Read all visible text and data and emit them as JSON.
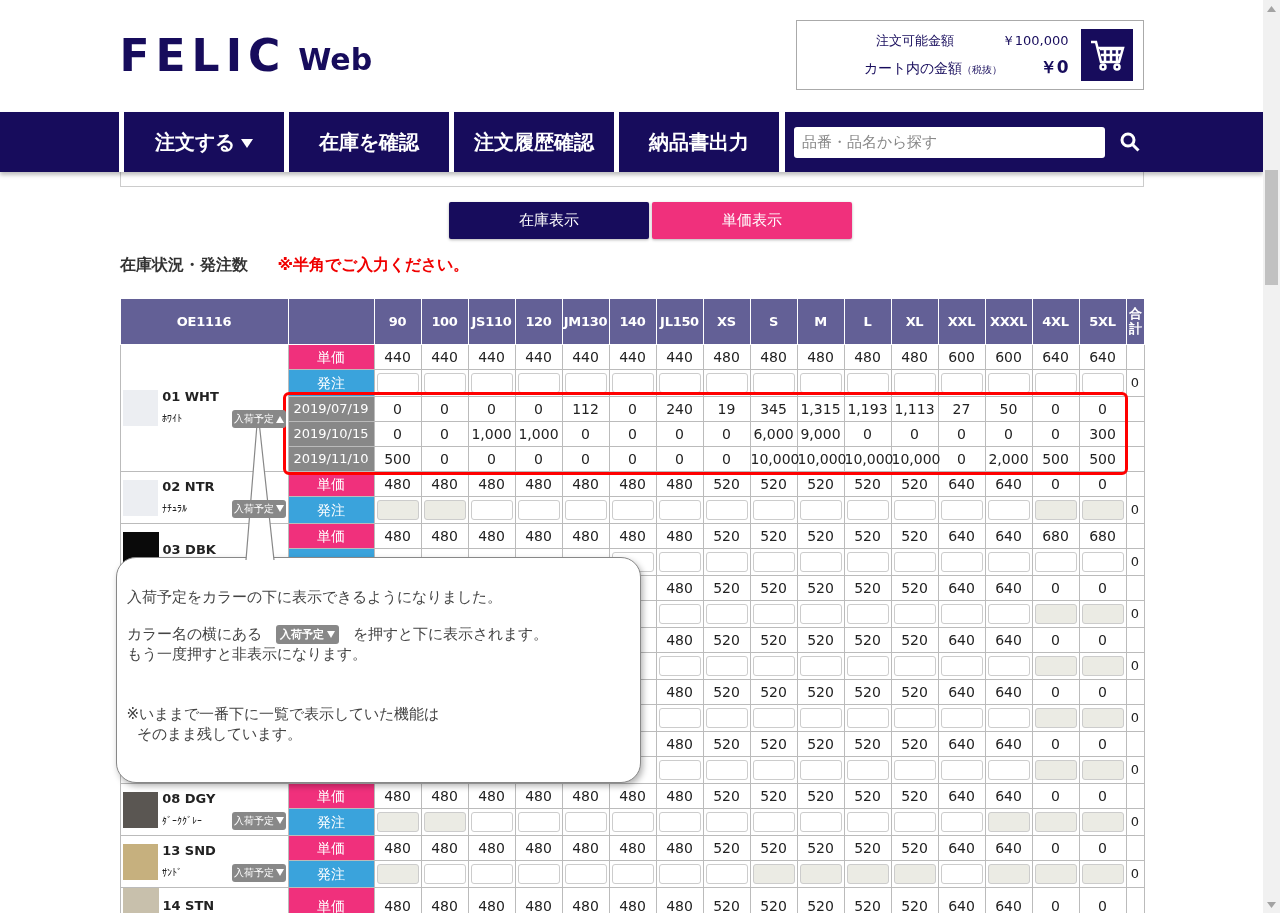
{
  "header": {
    "logo": "FELIC",
    "logo_suffix": "Web",
    "available_label": "注文可能金額",
    "available_value": "￥100,000",
    "cart_label": "カート内の金額",
    "cart_note": "（税抜）",
    "cart_value": "￥0"
  },
  "nav": {
    "items": [
      {
        "label": "注文する",
        "dropdown": true
      },
      {
        "label": "在庫を確認",
        "dropdown": false
      },
      {
        "label": "注文履歴確認",
        "dropdown": false
      },
      {
        "label": "納品書出力",
        "dropdown": false
      }
    ],
    "search": {
      "placeholder": "品番・品名から探す"
    }
  },
  "view_toggle": [
    {
      "label": "在庫表示",
      "selected": false
    },
    {
      "label": "単価表示",
      "selected": true
    }
  ],
  "heading": "在庫状況・発注数",
  "notice": "※半角でご入力ください。",
  "table": {
    "product": "OE1116",
    "sizes": [
      "90",
      "100",
      "JS110",
      "120",
      "JM130",
      "140",
      "JL150",
      "XS",
      "S",
      "M",
      "L",
      "XL",
      "XXL",
      "XXXL",
      "4XL",
      "5XL"
    ],
    "total_header": "合計",
    "blocks": [
      {
        "name": "01 WHT",
        "sub": "ﾎﾜｲﾄ",
        "color": "#eceef2",
        "arrivals_button": {
          "label": "入荷予定",
          "expanded": true
        },
        "price_label": "単価",
        "prices": [
          "440",
          "440",
          "440",
          "440",
          "440",
          "440",
          "440",
          "480",
          "480",
          "480",
          "480",
          "480",
          "600",
          "600",
          "640",
          "640"
        ],
        "order_label": "発注",
        "order_disabled": [
          false,
          false,
          false,
          false,
          false,
          false,
          false,
          false,
          false,
          false,
          false,
          false,
          false,
          false,
          false,
          false
        ],
        "total": "0",
        "arrivals": [
          {
            "date": "2019/07/19",
            "values": [
              "0",
              "0",
              "0",
              "0",
              "112",
              "0",
              "240",
              "19",
              "345",
              "1,315",
              "1,193",
              "1,113",
              "27",
              "50",
              "0",
              "0"
            ]
          },
          {
            "date": "2019/10/15",
            "values": [
              "0",
              "0",
              "1,000",
              "1,000",
              "0",
              "0",
              "0",
              "0",
              "6,000",
              "9,000",
              "0",
              "0",
              "0",
              "0",
              "0",
              "300"
            ]
          },
          {
            "date": "2019/11/10",
            "values": [
              "500",
              "0",
              "0",
              "0",
              "0",
              "0",
              "0",
              "0",
              "10,000",
              "10,000",
              "10,000",
              "10,000",
              "0",
              "2,000",
              "500",
              "500"
            ]
          }
        ]
      },
      {
        "name": "02 NTR",
        "sub": "ﾅﾁｭﾗﾙ",
        "color": "#eceef2",
        "arrivals_button": {
          "label": "入荷予定",
          "expanded": false
        },
        "price_label": "単価",
        "prices": [
          "480",
          "480",
          "480",
          "480",
          "480",
          "480",
          "480",
          "520",
          "520",
          "520",
          "520",
          "520",
          "640",
          "640",
          "0",
          "0"
        ],
        "order_label": "発注",
        "order_disabled": [
          true,
          true,
          false,
          false,
          false,
          false,
          false,
          false,
          false,
          false,
          false,
          false,
          false,
          false,
          true,
          true
        ],
        "total": "0"
      },
      {
        "name": "03 DBK",
        "color": "#0a0a0a",
        "price_label": "単価",
        "prices": [
          "480",
          "480",
          "480",
          "480",
          "480",
          "480",
          "480",
          "520",
          "520",
          "520",
          "520",
          "520",
          "640",
          "640",
          "680",
          "680"
        ],
        "order_disabled": [
          false,
          false,
          false,
          false,
          false,
          false,
          false,
          false,
          false,
          false,
          false
        ],
        "total": "0"
      },
      {
        "prices": [
          "480",
          "520",
          "520",
          "520",
          "520",
          "520",
          "640",
          "640",
          "0",
          "0"
        ],
        "order_disabled": [
          false,
          false,
          false,
          false,
          false,
          false,
          false,
          false,
          true,
          true
        ],
        "total": "0"
      },
      {
        "prices": [
          "480",
          "520",
          "520",
          "520",
          "520",
          "520",
          "640",
          "640",
          "0",
          "0"
        ],
        "order_disabled": [
          false,
          false,
          false,
          false,
          false,
          false,
          false,
          false,
          true,
          true
        ],
        "total": "0"
      },
      {
        "prices": [
          "480",
          "520",
          "520",
          "520",
          "520",
          "520",
          "640",
          "640",
          "0",
          "0"
        ],
        "order_disabled": [
          false,
          false,
          false,
          false,
          false,
          false,
          false,
          false,
          true,
          true
        ],
        "total": "0"
      },
      {
        "prices": [
          "480",
          "520",
          "520",
          "520",
          "520",
          "520",
          "640",
          "640",
          "0",
          "0"
        ],
        "order_disabled": [
          false,
          false,
          false,
          false,
          false,
          false,
          false,
          false,
          true,
          true
        ],
        "total": "0"
      },
      {
        "name": "08 DGY",
        "sub": "ﾀﾞｰｸｸﾞﾚｰ",
        "color": "#5a5652",
        "arrivals_button": {
          "label": "入荷予定",
          "expanded": false
        },
        "price_label": "単価",
        "prices": [
          "480",
          "480",
          "480",
          "480",
          "480",
          "480",
          "480",
          "520",
          "520",
          "520",
          "520",
          "520",
          "640",
          "640",
          "0",
          "0"
        ],
        "order_label": "発注",
        "order_disabled": [
          true,
          true,
          false,
          false,
          false,
          false,
          false,
          false,
          false,
          false,
          false,
          false,
          false,
          true,
          true,
          true
        ],
        "total": "0"
      },
      {
        "name": "13 SND",
        "sub": "ｻﾝﾄﾞ",
        "color": "#c6b07e",
        "arrivals_button": {
          "label": "入荷予定",
          "expanded": false
        },
        "price_label": "単価",
        "prices": [
          "480",
          "480",
          "480",
          "480",
          "480",
          "480",
          "480",
          "520",
          "520",
          "520",
          "520",
          "520",
          "640",
          "640",
          "0",
          "0"
        ],
        "order_label": "発注",
        "order_disabled": [
          true,
          false,
          false,
          false,
          false,
          false,
          false,
          false,
          true,
          true,
          true,
          true,
          false,
          true,
          true,
          true
        ],
        "total": "0"
      },
      {
        "name": "14 STN",
        "color": "#c8c0ac",
        "price_label": "単価",
        "prices": [
          "480",
          "480",
          "480",
          "480",
          "480",
          "480",
          "480",
          "520",
          "520",
          "520",
          "520",
          "520",
          "640",
          "640",
          "0",
          "0"
        ]
      }
    ]
  },
  "callout": {
    "intro": "入荷予定をカラーの下に表示できるようになりました。",
    "instruction": {
      "before": "カラー名の横にある",
      "button": "入荷予定",
      "after": "を押すと下に表示されます。"
    },
    "hide_hint": "もう一度押すと非表示になります。",
    "note": [
      "※いままで一番下に一覧で表示していた機能は",
      "そのまま残しています。"
    ]
  }
}
